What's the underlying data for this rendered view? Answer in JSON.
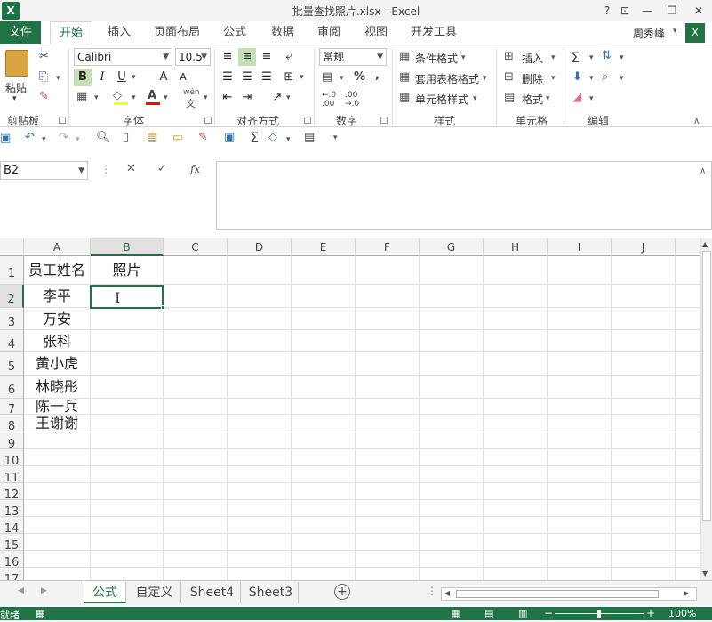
{
  "window": {
    "title": "批量查找照片.xlsx - Excel",
    "app_icon": "X"
  },
  "tabs": {
    "file": "文件",
    "items": [
      "开始",
      "插入",
      "页面布局",
      "公式",
      "数据",
      "审阅",
      "视图",
      "开发工具"
    ],
    "active": "开始",
    "user": "周秀峰"
  },
  "ribbon": {
    "clipboard": {
      "label": "剪贴板",
      "paste": "粘贴"
    },
    "font": {
      "label": "字体",
      "name": "Calibri",
      "size": "10.5",
      "bold": "B",
      "italic": "I",
      "underline": "U",
      "grow": "A",
      "shrink": "A",
      "wen": "wén"
    },
    "alignment": {
      "label": "对齐方式"
    },
    "number": {
      "label": "数字",
      "format": "常规",
      "percent": "%",
      "comma": ","
    },
    "styles": {
      "label": "样式",
      "conditional": "条件格式",
      "table": "套用表格格式",
      "cell": "单元格样式"
    },
    "cells": {
      "label": "单元格",
      "insert": "插入",
      "delete": "删除",
      "format": "格式"
    },
    "editing": {
      "label": "编辑"
    }
  },
  "formula_bar": {
    "name_box": "B2",
    "fx": "fx",
    "value": ""
  },
  "columns": [
    "A",
    "B",
    "C",
    "D",
    "E",
    "F",
    "G",
    "H",
    "I",
    "J"
  ],
  "rows": [
    "1",
    "2",
    "3",
    "4",
    "5",
    "6",
    "7",
    "8",
    "9",
    "10",
    "11",
    "12",
    "13",
    "14",
    "15",
    "16",
    "17"
  ],
  "cells": {
    "A1": "员工姓名",
    "B1": "照片",
    "A2": "李平",
    "A3": "万安",
    "A4": "张科",
    "A5": "黄小虎",
    "A6": "林晓彤",
    "A7": "陈一兵",
    "A8": "王谢谢"
  },
  "selected_cell": "B2",
  "sheets": [
    "公式",
    "自定义",
    "Sheet4",
    "Sheet3"
  ],
  "active_sheet": "公式",
  "status": {
    "ready": "就绪",
    "zoom": "100%"
  },
  "colors": {
    "accent": "#217346"
  }
}
